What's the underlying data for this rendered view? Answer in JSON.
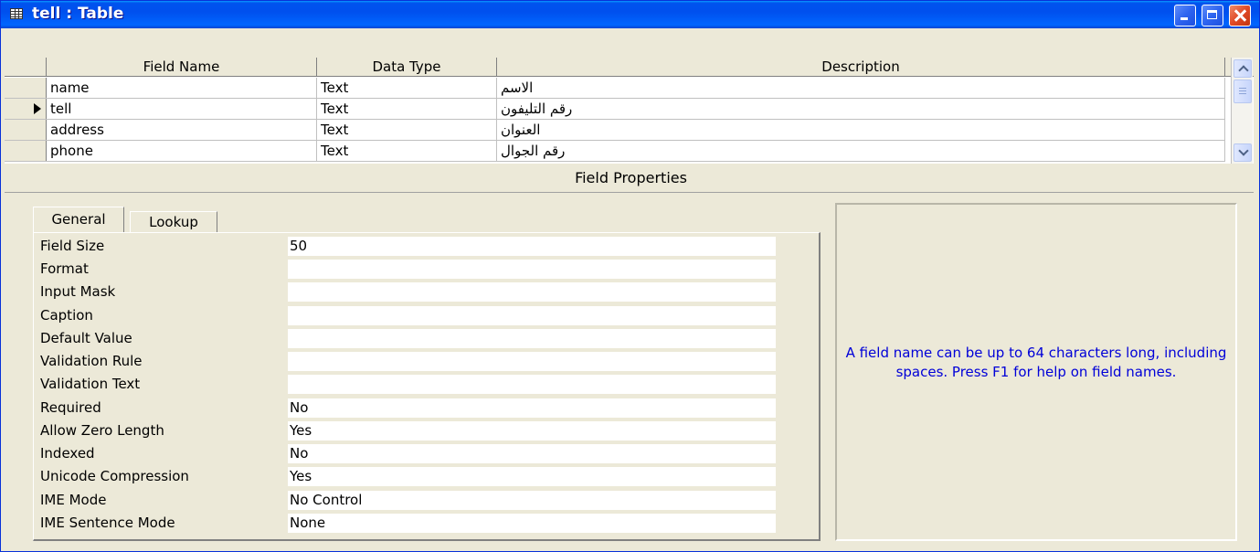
{
  "window": {
    "title": "tell : Table",
    "icon": "table-icon"
  },
  "columns": {
    "field_name": "Field Name",
    "data_type": "Data Type",
    "description": "Description"
  },
  "rows": [
    {
      "field_name": "name",
      "data_type": "Text",
      "description": "الاسم",
      "current": false
    },
    {
      "field_name": "tell",
      "data_type": "Text",
      "description": "رقم التليفون",
      "current": true
    },
    {
      "field_name": "address",
      "data_type": "Text",
      "description": "العنوان",
      "current": false
    },
    {
      "field_name": "phone",
      "data_type": "Text",
      "description": "رقم الجوال",
      "current": false
    }
  ],
  "field_properties": {
    "title": "Field Properties",
    "tabs": {
      "general": "General",
      "lookup": "Lookup"
    },
    "active_tab": "General",
    "props": [
      {
        "label": "Field Size",
        "value": "50"
      },
      {
        "label": "Format",
        "value": ""
      },
      {
        "label": "Input Mask",
        "value": ""
      },
      {
        "label": "Caption",
        "value": ""
      },
      {
        "label": "Default Value",
        "value": ""
      },
      {
        "label": "Validation Rule",
        "value": ""
      },
      {
        "label": "Validation Text",
        "value": ""
      },
      {
        "label": "Required",
        "value": "No"
      },
      {
        "label": "Allow Zero Length",
        "value": "Yes"
      },
      {
        "label": "Indexed",
        "value": "No"
      },
      {
        "label": "Unicode Compression",
        "value": "Yes"
      },
      {
        "label": "IME Mode",
        "value": "No Control"
      },
      {
        "label": "IME Sentence Mode",
        "value": "None"
      }
    ],
    "help": "A field name can be up to 64 characters long, including spaces.  Press F1 for help on field names."
  },
  "colors": {
    "title_bar": "#0054e3",
    "help_text": "#0000d8",
    "face": "#ece9d8"
  }
}
